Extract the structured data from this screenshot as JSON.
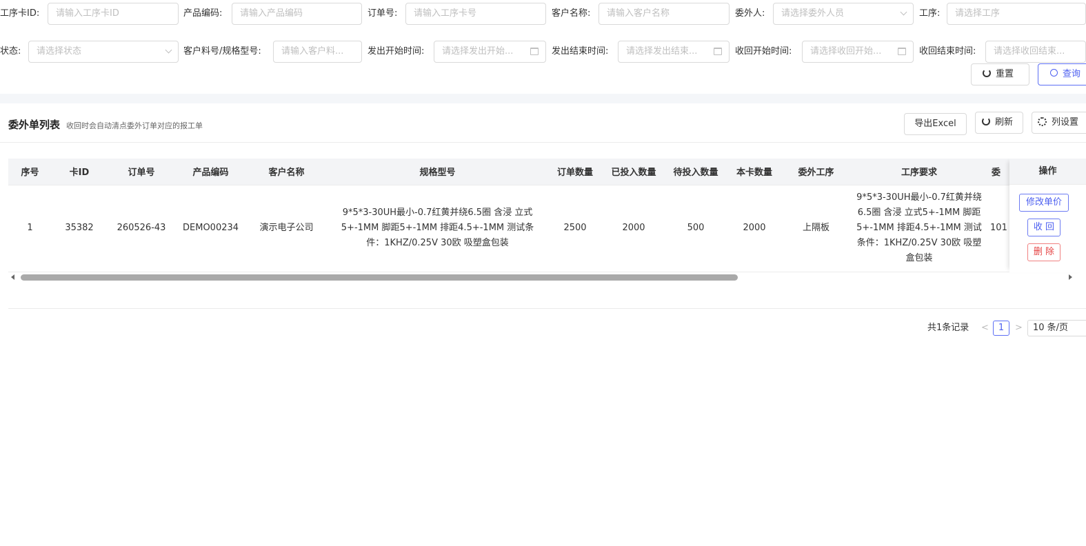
{
  "filters": {
    "row1": [
      {
        "label": "工序卡ID:",
        "placeholder": "请输入工序卡ID"
      },
      {
        "label": "产品编码:",
        "placeholder": "请输入产品编码"
      },
      {
        "label": "订单号:",
        "placeholder": "请输入工序卡号"
      },
      {
        "label": "客户名称:",
        "placeholder": "请输入客户名称"
      },
      {
        "label": "委外人:",
        "placeholder": "请选择委外人员",
        "icon": "chevron-down-icon"
      },
      {
        "label": "工序:",
        "placeholder": "请选择工序"
      }
    ],
    "row2": [
      {
        "label": "状态:",
        "placeholder": "请选择状态",
        "icon": "chevron-down-icon"
      },
      {
        "label": "客户料号/规格型号:",
        "placeholder": "请输入客户料..."
      },
      {
        "label": "发出开始时间:",
        "placeholder": "请选择发出开始...",
        "icon": "calendar-icon"
      },
      {
        "label": "发出结束时间:",
        "placeholder": "请选择发出结束...",
        "icon": "calendar-icon"
      },
      {
        "label": "收回开始时间:",
        "placeholder": "请选择收回开始...",
        "icon": "calendar-icon"
      },
      {
        "label": "收回结束时间:",
        "placeholder": "请选择收回结束...",
        "icon": "calendar-icon"
      }
    ],
    "reset_label": "重置",
    "search_label": "查询"
  },
  "card": {
    "title": "委外单列表",
    "subtitle": "收回时会自动清点委外订单对应的报工单",
    "export_label": "导出Excel",
    "refresh_label": "刷新",
    "columns_label": "列设置"
  },
  "table": {
    "headers": [
      "序号",
      "卡ID",
      "订单号",
      "产品编码",
      "客户名称",
      "规格型号",
      "订单数量",
      "已投入数量",
      "待投入数量",
      "本卡数量",
      "委外工序",
      "工序要求",
      "委"
    ],
    "ops_header": "操作",
    "rows": [
      {
        "cells": [
          "1",
          "35382",
          "260526-43",
          "DEMO00234",
          "演示电子公司",
          "9*5*3-30UH最小-0.7红黄并绕6.5圈 含浸 立式5+-1MM 脚距5+-1MM 排距4.5+-1MM 测试条件：1KHZ/0.25V 30欧 吸塑盒包装",
          "2500",
          "2000",
          "500",
          "2000",
          "上隔板",
          "9*5*3-30UH最小-0.7红黄并绕6.5圈 含浸 立式5+-1MM 脚距5+-1MM 排距4.5+-1MM 测试条件：1KHZ/0.25V 30欧 吸塑盒包装",
          "101"
        ],
        "ops": [
          "修改单价",
          "收 回",
          "删 除"
        ]
      }
    ]
  },
  "pagination": {
    "total": "共1条记录",
    "prev": "<",
    "current": "1",
    "next": ">",
    "page_size": "10 条/页"
  },
  "colors": {
    "accent": "#4c5ff0",
    "danger": "#e54545",
    "header_bg": "#f3f4f6"
  }
}
